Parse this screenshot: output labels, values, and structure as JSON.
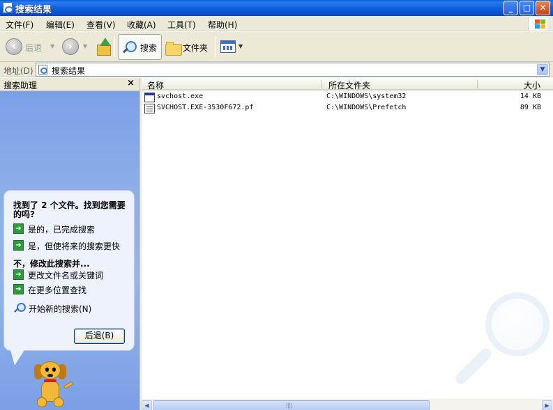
{
  "window": {
    "title": "搜索结果",
    "controls": {
      "minimize": "_",
      "maximize": "□",
      "close": "✕"
    }
  },
  "menu": {
    "items": [
      "文件(F)",
      "编辑(E)",
      "查看(V)",
      "收藏(A)",
      "工具(T)",
      "帮助(H)"
    ]
  },
  "toolbar": {
    "back_label": "后退",
    "search_label": "搜索",
    "folders_label": "文件夹",
    "icons": [
      "back-arrow-icon",
      "forward-arrow-icon",
      "up-folder-icon",
      "search-icon",
      "folder-icon",
      "views-icon"
    ]
  },
  "address": {
    "label": "地址(D)",
    "value": "搜索结果"
  },
  "assistant": {
    "title": "搜索助理",
    "close_glyph": "×",
    "question": "找到了 2 个文件。找到您需要的吗?",
    "options_yes": [
      "是的，已完成搜索",
      "是，但使将来的搜索更快"
    ],
    "subheading": "不，修改此搜索并...",
    "options_modify": [
      "更改文件名或关键词",
      "在更多位置查找"
    ],
    "new_search": "开始新的搜索(N)",
    "back_button": "后退(B)",
    "arrow_glyph": "➔"
  },
  "filelist": {
    "columns": [
      "名称",
      "所在文件夹",
      "大小"
    ],
    "rows": [
      {
        "name": "svchost.exe",
        "folder": "C:\\WINDOWS\\system32",
        "size": "14 KB",
        "icon": "exe"
      },
      {
        "name": "SVCHOST.EXE-3530F672.pf",
        "folder": "C:\\WINDOWS\\Prefetch",
        "size": "89 KB",
        "icon": "pf"
      }
    ]
  },
  "scrollbar": {
    "left": "◀",
    "right": "▶"
  },
  "colors": {
    "titlebar": "#0a5fd8",
    "assistant_bg": "#8aace8",
    "chrome": "#ece9d8"
  }
}
